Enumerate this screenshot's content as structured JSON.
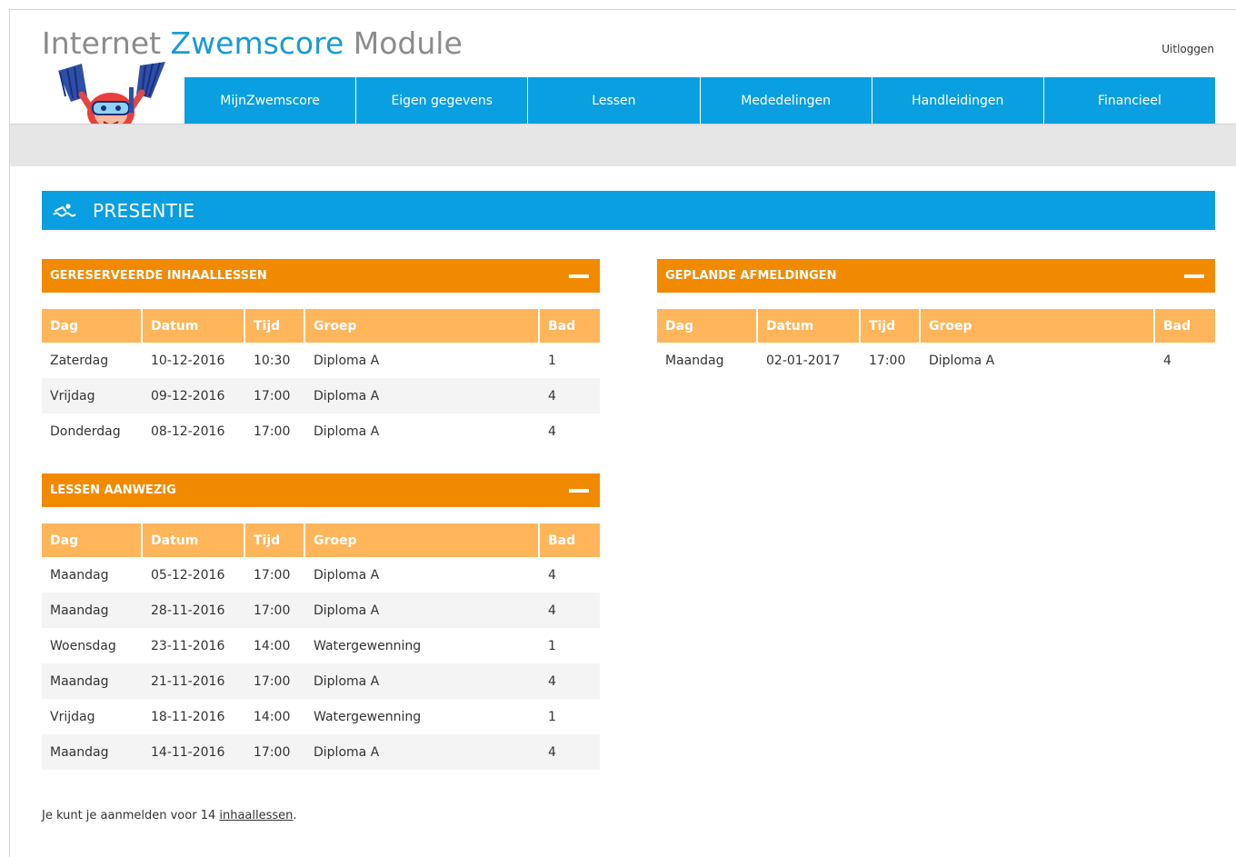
{
  "header": {
    "brand_part1": "Internet",
    "brand_part2": "Zwemscore",
    "brand_part3": "Module",
    "logout_label": "Uitloggen"
  },
  "nav": {
    "items": [
      "MijnZwemscore",
      "Eigen gegevens",
      "Lessen",
      "Mededelingen",
      "Handleidingen",
      "Financieel"
    ]
  },
  "page": {
    "title": "PRESENTIE",
    "icon": "swimmer-icon"
  },
  "colors": {
    "accent_blue": "#0a9fe0",
    "panel_orange": "#f28a00",
    "table_header_orange": "#ffb55a"
  },
  "columns": [
    "Dag",
    "Datum",
    "Tijd",
    "Groep",
    "Bad"
  ],
  "inhaallessen": {
    "title": "GERESERVEERDE INHAALLESSEN",
    "rows": [
      [
        "Zaterdag",
        "10-12-2016",
        "10:30",
        "Diploma A",
        "1"
      ],
      [
        "Vrijdag",
        "09-12-2016",
        "17:00",
        "Diploma A",
        "4"
      ],
      [
        "Donderdag",
        "08-12-2016",
        "17:00",
        "Diploma A",
        "4"
      ]
    ]
  },
  "aanwezig": {
    "title": "LESSEN AANWEZIG",
    "rows": [
      [
        "Maandag",
        "05-12-2016",
        "17:00",
        "Diploma A",
        "4"
      ],
      [
        "Maandag",
        "28-11-2016",
        "17:00",
        "Diploma A",
        "4"
      ],
      [
        "Woensdag",
        "23-11-2016",
        "14:00",
        "Watergewenning",
        "1"
      ],
      [
        "Maandag",
        "21-11-2016",
        "17:00",
        "Diploma A",
        "4"
      ],
      [
        "Vrijdag",
        "18-11-2016",
        "14:00",
        "Watergewenning",
        "1"
      ],
      [
        "Maandag",
        "14-11-2016",
        "17:00",
        "Diploma A",
        "4"
      ]
    ]
  },
  "afmeldingen": {
    "title": "GEPLANDE AFMELDINGEN",
    "rows": [
      [
        "Maandag",
        "02-01-2017",
        "17:00",
        "Diploma A",
        "4"
      ]
    ]
  },
  "footer": {
    "text_before": "Je kunt je aanmelden voor 14 ",
    "link": "inhaallessen",
    "text_after": "."
  }
}
